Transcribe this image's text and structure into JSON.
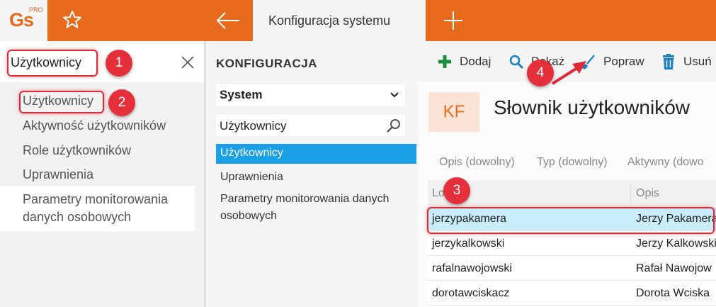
{
  "app": {
    "logo_text": "Gs",
    "logo_super": "PRO",
    "active_tab": "Konfiguracja systemu"
  },
  "left": {
    "search_value": "Użytkownicy",
    "items": [
      "Użytkownicy",
      "Aktywność użytkowników",
      "Role użytkowników",
      "Uprawnienia",
      "Parametry monitorowania",
      "danych osobowych"
    ]
  },
  "middle": {
    "header": "KONFIGURACJA",
    "select_value": "System",
    "search_value": "Użytkownicy",
    "items": [
      "Użytkownicy",
      "Uprawnienia",
      "Parametry monitorowania danych",
      "osobowych"
    ]
  },
  "toolbar": {
    "add": "Dodaj",
    "show": "Pokaż",
    "edit": "Popraw",
    "delete": "Usuń"
  },
  "dictionary": {
    "badge": "KF",
    "title": "Słownik użytkowników",
    "filters": [
      "Opis (dowolny)",
      "Typ (dowolny)",
      "Aktywny (dowo"
    ],
    "columns": [
      "Login",
      "Opis"
    ],
    "rows": [
      {
        "login": "jerzypakamera",
        "opis": "Jerzy Pakamera"
      },
      {
        "login": "jerzykalkowski",
        "opis": "Jerzy Kalkowski"
      },
      {
        "login": "rafalnawojowski",
        "opis": "Rafał Nawojow"
      },
      {
        "login": "dorotawciskacz",
        "opis": "Dorota Wciska"
      }
    ]
  },
  "annotations": {
    "steps": [
      "1",
      "2",
      "3",
      "4"
    ],
    "color": "#e02a3a"
  },
  "colors": {
    "brand": "#e86a1d",
    "selection": "#1b9fe6",
    "row_selected": "#c9ecf9",
    "add_icon": "#1a8f3a",
    "action_icon": "#1b7fc6"
  },
  "icons": [
    "star-icon",
    "back-arrow-icon",
    "plus-icon",
    "close-icon",
    "chevron-down-icon",
    "search-icon",
    "add-icon",
    "show-icon",
    "edit-brush-icon",
    "delete-icon"
  ]
}
